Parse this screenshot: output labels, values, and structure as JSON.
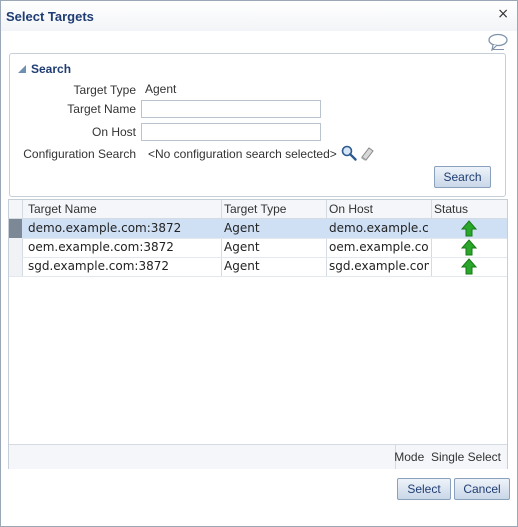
{
  "dialog": {
    "title": "Select Targets",
    "close_label": "×"
  },
  "search": {
    "header": "Search",
    "target_type_label": "Target Type",
    "target_type_value": "Agent",
    "target_name_label": "Target Name",
    "target_name_value": "",
    "on_host_label": "On Host",
    "on_host_value": "",
    "config_search_label": "Configuration Search",
    "config_search_value": "<No configuration search selected>",
    "search_button": "Search"
  },
  "table": {
    "columns": [
      "Target Name",
      "Target Type",
      "On Host",
      "Status"
    ],
    "rows": [
      {
        "target_name": "demo.example.com:3872",
        "target_type": "Agent",
        "on_host": "demo.example.c...",
        "status": "up"
      },
      {
        "target_name": "oem.example.com:3872",
        "target_type": "Agent",
        "on_host": "oem.example.com",
        "status": "up"
      },
      {
        "target_name": "sgd.example.com:3872",
        "target_type": "Agent",
        "on_host": "sgd.example.com",
        "status": "up"
      }
    ],
    "mode_label": "Mode",
    "mode_value": "Single Select"
  },
  "actions": {
    "select": "Select",
    "cancel": "Cancel"
  },
  "colors": {
    "accent": "#1f3d73",
    "selected_row": "#cfe0f5",
    "status_up": "#2aa72a"
  },
  "icons": [
    "help-icon",
    "search-icon",
    "clear-icon",
    "status-up-arrow-icon",
    "close-icon"
  ]
}
